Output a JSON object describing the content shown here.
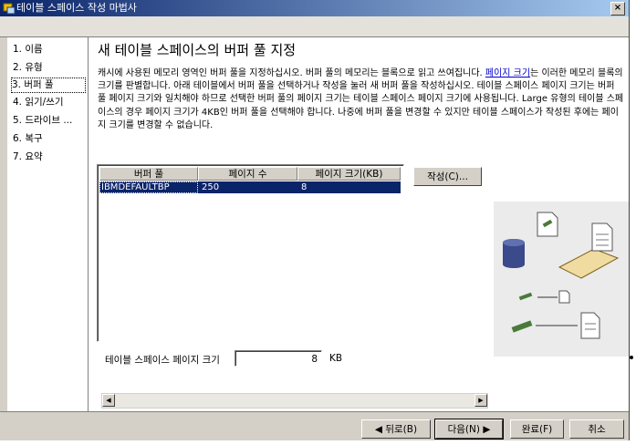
{
  "window": {
    "title": "테이블 스페이스 작성 마법사",
    "close_glyph": "×"
  },
  "nav": {
    "items": [
      {
        "label": "1. 이름"
      },
      {
        "label": "2. 유형"
      },
      {
        "label": "3. 버퍼 풀"
      },
      {
        "label": "4. 읽기/쓰기"
      },
      {
        "label": "5. 드라이브 ..."
      },
      {
        "label": "6. 복구"
      },
      {
        "label": "7. 요약"
      }
    ],
    "selected_index": 2
  },
  "main": {
    "heading": "새 테이블 스페이스의 버퍼 풀 지정",
    "description_part1": "캐시에 사용된 메모리 영역인 버퍼 풀을 지정하십시오. 버퍼 풀의 메모리는 블록으로 읽고 쓰여집니다. ",
    "description_link": "페이지 크기",
    "description_part2": "는 이러한 메모리 블록의 크기를 판별합니다. 아래 테이블에서 버퍼 풀을 선택하거나 작성을 눌러 새 버퍼 풀을 작성하십시오. 테이블 스페이스 페이지 크기는 버퍼 풀 페이지 크기와 일치해야 하므로 선택한 버퍼 풀의 페이지 크기는 테이블 스페이스 페이지 크기에 사용됩니다. Large 유형의 테이블 스페이스의 경우 페이지 크기가 4KB인 버퍼 풀을 선택해야 합니다. 나중에 버퍼 풀을 변경할 수 있지만 테이블 스페이스가 작성된 후에는 페이지 크기를 변경할 수 없습니다.",
    "table": {
      "columns": [
        "버퍼 풀",
        "페이지 수",
        "페이지 크기(KB)"
      ],
      "rows": [
        {
          "name": "IBMDEFAULTBP",
          "pages": "250",
          "page_size": "8"
        }
      ]
    },
    "create_button": "작성(C)...",
    "page_size_label": "테이블 스페이스 페이지 크기",
    "page_size_value": "8",
    "page_size_unit": "KB"
  },
  "buttons": {
    "back": "◀ 뒤로(B)",
    "next": "다음(N) ▶",
    "finish": "완료(F)",
    "cancel": "취소"
  },
  "scrollbar": {
    "left_arrow": "◀",
    "right_arrow": "▶"
  },
  "colors": {
    "title_start": "#0a246a",
    "title_end": "#a6caf0",
    "selection": "#0a246a",
    "link": "#0000cc"
  }
}
